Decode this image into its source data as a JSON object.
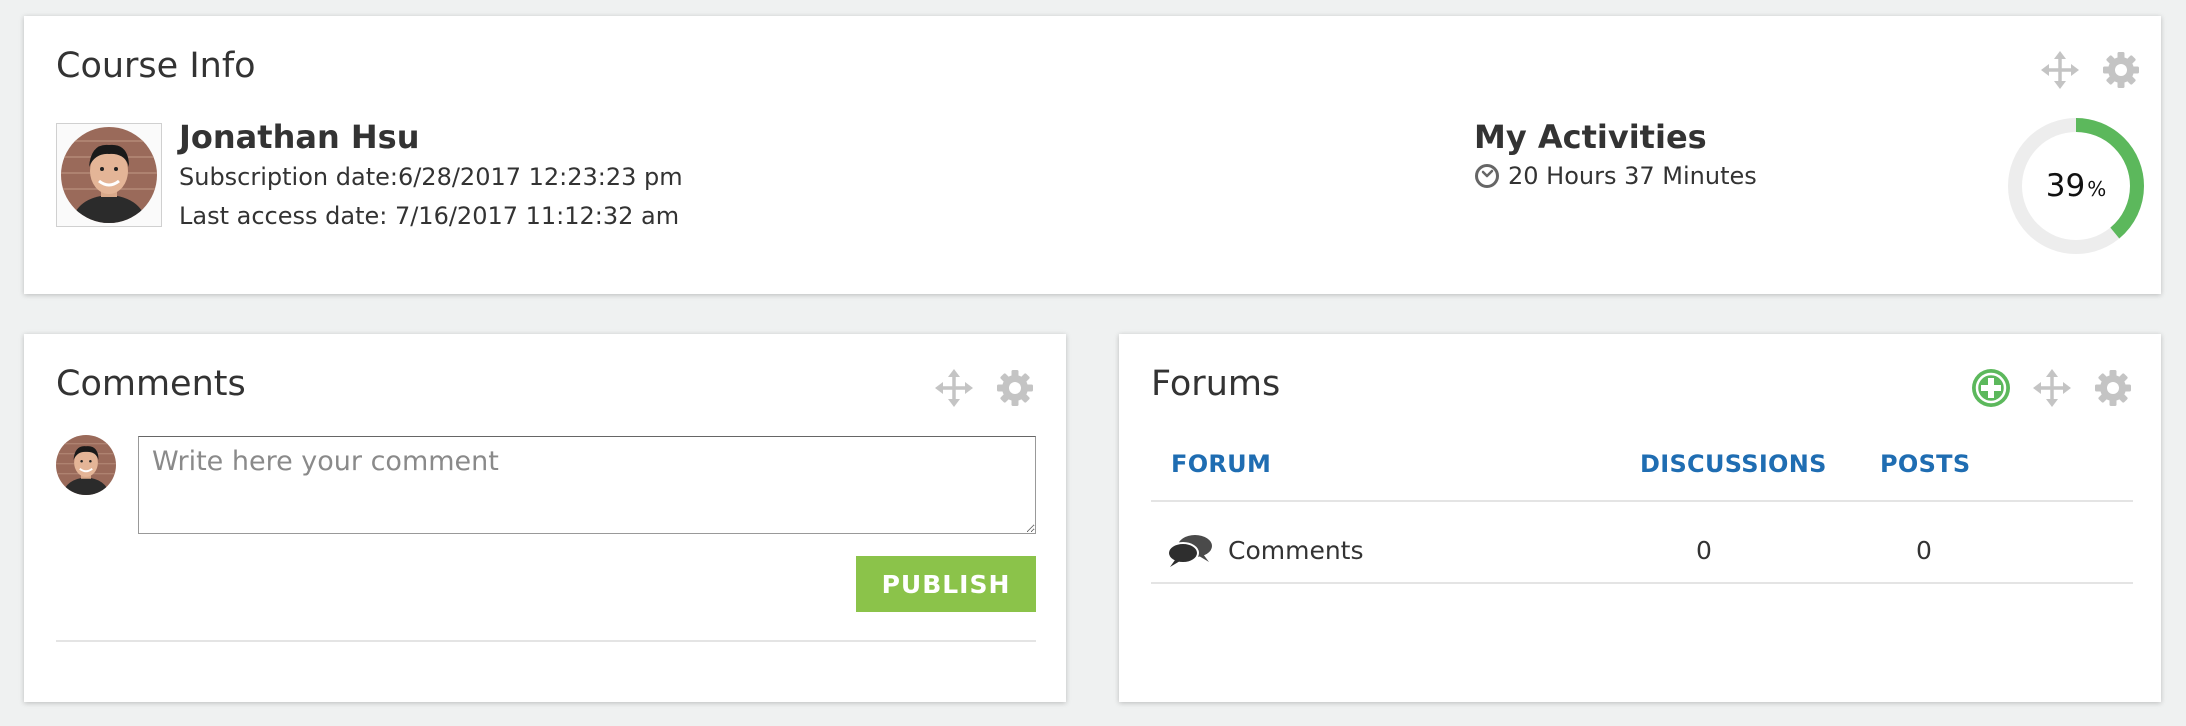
{
  "course_info": {
    "title": "Course Info",
    "user_name": "Jonathan Hsu",
    "subscription": "Subscription date:6/28/2017 12:23:23 pm",
    "last_access": "Last access date: 7/16/2017 11:12:32 am",
    "activities_title": "My Activities",
    "time_spent": "20 Hours 37 Minutes",
    "progress_value": "39",
    "progress_symbol": "%",
    "progress_fraction": 0.39,
    "progress_color": "#5cb85c"
  },
  "comments": {
    "title": "Comments",
    "placeholder": "Write here your comment",
    "publish_label": "PUBLISH",
    "publish_color": "#8bc34a"
  },
  "forums": {
    "title": "Forums",
    "columns": [
      "FORUM",
      "DISCUSSIONS",
      "POSTS"
    ],
    "rows": [
      {
        "name": "Comments",
        "discussions": "0",
        "posts": "0"
      }
    ],
    "add_color": "#5cb85c",
    "header_color": "#1f6db2"
  },
  "icons": {
    "move": "move-icon",
    "settings": "gear-icon",
    "add": "plus-circle-icon",
    "clock": "clock-icon",
    "chat": "chat-bubbles-icon"
  }
}
